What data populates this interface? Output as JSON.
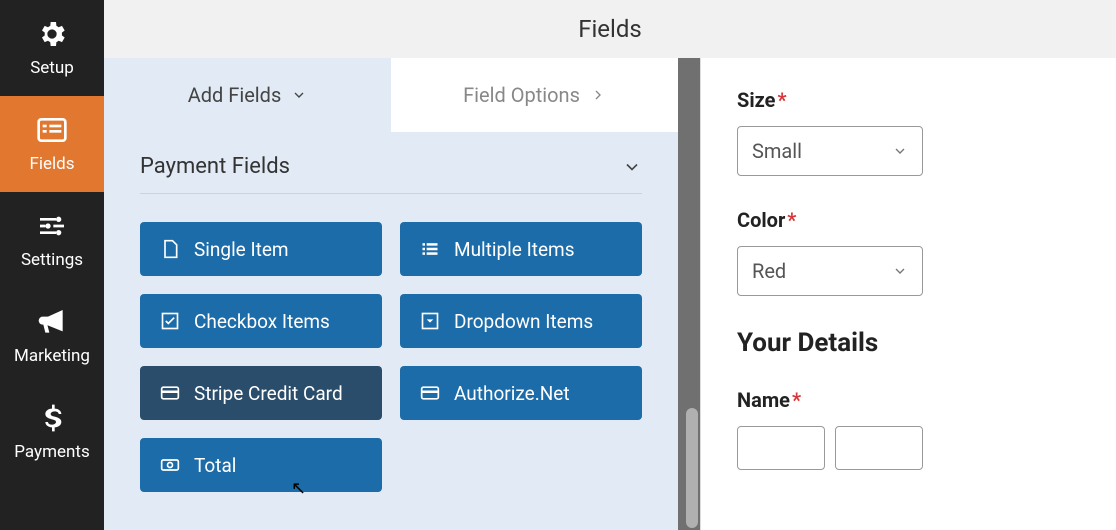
{
  "header": {
    "title": "Fields"
  },
  "sidebar": {
    "items": [
      {
        "label": "Setup"
      },
      {
        "label": "Fields"
      },
      {
        "label": "Settings"
      },
      {
        "label": "Marketing"
      },
      {
        "label": "Payments"
      }
    ]
  },
  "leftPanel": {
    "tabs": {
      "add": "Add Fields",
      "options": "Field Options"
    },
    "section": "Payment Fields",
    "buttons": {
      "single": "Single Item",
      "multiple": "Multiple Items",
      "checkbox": "Checkbox Items",
      "dropdown": "Dropdown Items",
      "stripe": "Stripe Credit Card",
      "authorize": "Authorize.Net",
      "total": "Total"
    }
  },
  "form": {
    "size": {
      "label": "Size",
      "value": "Small"
    },
    "color": {
      "label": "Color",
      "value": "Red"
    },
    "detailsHeading": "Your Details",
    "name": {
      "label": "Name"
    }
  }
}
